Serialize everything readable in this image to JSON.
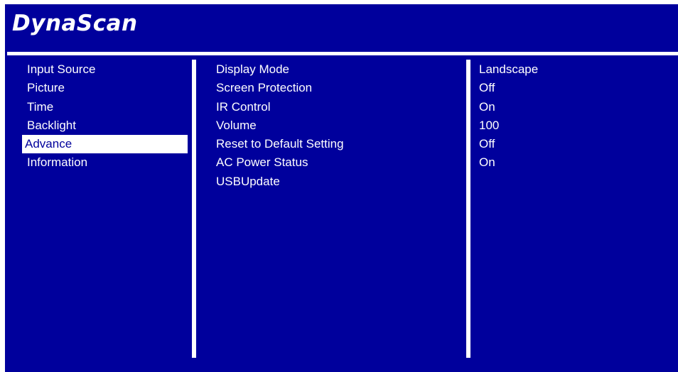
{
  "brand": "DynaScan",
  "menu": {
    "items": [
      {
        "label": "Input Source"
      },
      {
        "label": "Picture"
      },
      {
        "label": "Time"
      },
      {
        "label": "Backlight"
      },
      {
        "label": "Advance",
        "selected": true
      },
      {
        "label": "Information"
      }
    ]
  },
  "settings": {
    "items": [
      {
        "label": "Display Mode",
        "value": "Landscape"
      },
      {
        "label": "Screen Protection",
        "value": "Off"
      },
      {
        "label": "IR Control",
        "value": "On"
      },
      {
        "label": "Volume",
        "value": "100"
      },
      {
        "label": "Reset to Default Setting",
        "value": "Off"
      },
      {
        "label": "AC Power Status",
        "value": "On"
      },
      {
        "label": "USBUpdate",
        "value": ""
      }
    ]
  },
  "colors": {
    "background": "#00009c",
    "foreground": "#ffffff",
    "selected_background": "#ffffff",
    "selected_text": "#00009c"
  }
}
